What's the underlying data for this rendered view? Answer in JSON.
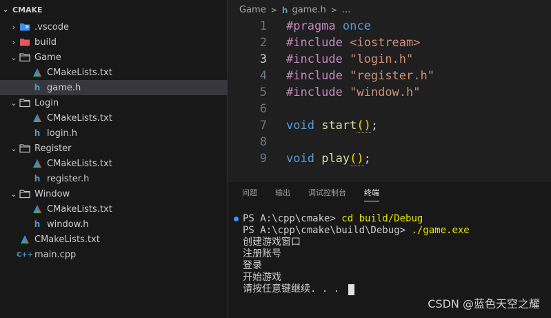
{
  "explorer": {
    "title": "CMAKE",
    "items": [
      {
        "label": ".vscode",
        "depth": 1,
        "type": "folder-vscode",
        "expanded": false
      },
      {
        "label": "build",
        "depth": 1,
        "type": "folder-build",
        "expanded": false
      },
      {
        "label": "Game",
        "depth": 1,
        "type": "folder",
        "expanded": true
      },
      {
        "label": "CMakeLists.txt",
        "depth": 2,
        "type": "cmake"
      },
      {
        "label": "game.h",
        "depth": 2,
        "type": "h",
        "selected": true
      },
      {
        "label": "Login",
        "depth": 1,
        "type": "folder",
        "expanded": true
      },
      {
        "label": "CMakeLists.txt",
        "depth": 2,
        "type": "cmake"
      },
      {
        "label": "login.h",
        "depth": 2,
        "type": "h"
      },
      {
        "label": "Register",
        "depth": 1,
        "type": "folder",
        "expanded": true
      },
      {
        "label": "CMakeLists.txt",
        "depth": 2,
        "type": "cmake"
      },
      {
        "label": "register.h",
        "depth": 2,
        "type": "h"
      },
      {
        "label": "Window",
        "depth": 1,
        "type": "folder",
        "expanded": true
      },
      {
        "label": "CMakeLists.txt",
        "depth": 2,
        "type": "cmake"
      },
      {
        "label": "window.h",
        "depth": 2,
        "type": "h"
      },
      {
        "label": "CMakeLists.txt",
        "depth": 1,
        "type": "cmake"
      },
      {
        "label": "main.cpp",
        "depth": 1,
        "type": "cpp"
      }
    ]
  },
  "breadcrumb": {
    "folder": "Game",
    "file": "game.h",
    "more": "..."
  },
  "editor": {
    "active_line": 3,
    "lines": [
      {
        "n": "1",
        "t": [
          [
            "kw",
            "#pragma"
          ],
          [
            "plain",
            " "
          ],
          [
            "once",
            "once"
          ]
        ]
      },
      {
        "n": "2",
        "t": [
          [
            "kw",
            "#include"
          ],
          [
            "plain",
            " "
          ],
          [
            "str",
            "<iostream>"
          ]
        ]
      },
      {
        "n": "3",
        "t": [
          [
            "kw",
            "#include"
          ],
          [
            "plain",
            " "
          ],
          [
            "str",
            "\"login.h\""
          ]
        ]
      },
      {
        "n": "4",
        "t": [
          [
            "kw",
            "#include"
          ],
          [
            "plain",
            " "
          ],
          [
            "str",
            "\"register.h\""
          ]
        ]
      },
      {
        "n": "5",
        "t": [
          [
            "kw",
            "#include"
          ],
          [
            "plain",
            " "
          ],
          [
            "str",
            "\"window.h\""
          ]
        ]
      },
      {
        "n": "6",
        "t": []
      },
      {
        "n": "7",
        "t": [
          [
            "ty",
            "void"
          ],
          [
            "plain",
            " "
          ],
          [
            "fn",
            "start"
          ],
          [
            "pn",
            "()"
          ],
          [
            "plain",
            ";"
          ]
        ]
      },
      {
        "n": "8",
        "t": []
      },
      {
        "n": "9",
        "t": [
          [
            "ty",
            "void"
          ],
          [
            "plain",
            " "
          ],
          [
            "fn",
            "play"
          ],
          [
            "pn",
            "()"
          ],
          [
            "plain",
            ";"
          ]
        ]
      }
    ]
  },
  "panel": {
    "tabs": [
      {
        "label": "问题",
        "active": false
      },
      {
        "label": "输出",
        "active": false
      },
      {
        "label": "调试控制台",
        "active": false
      },
      {
        "label": "终端",
        "active": true
      }
    ],
    "terminal": [
      {
        "dot": true,
        "prompt": "PS A:\\cpp\\cmake> ",
        "cmd": "cd build/Debug"
      },
      {
        "dot": false,
        "prompt": "PS A:\\cpp\\cmake\\build\\Debug> ",
        "cmd": "./game.exe"
      },
      {
        "dot": false,
        "prompt": "创建游戏窗口",
        "cmd": ""
      },
      {
        "dot": false,
        "prompt": "注册账号",
        "cmd": ""
      },
      {
        "dot": false,
        "prompt": "登录",
        "cmd": ""
      },
      {
        "dot": false,
        "prompt": "开始游戏",
        "cmd": ""
      },
      {
        "dot": false,
        "prompt": "请按任意键继续. . . ",
        "cmd": "",
        "cursor": true
      }
    ]
  },
  "watermark": "CSDN @蓝色天空之耀",
  "colors": {
    "keyword": "#c586c0",
    "type": "#569cd6",
    "string": "#ce9178",
    "function": "#dcdcaa",
    "bracket": "#ffd700",
    "selection": "#37373d",
    "terminal_cmd": "#e5e510"
  }
}
